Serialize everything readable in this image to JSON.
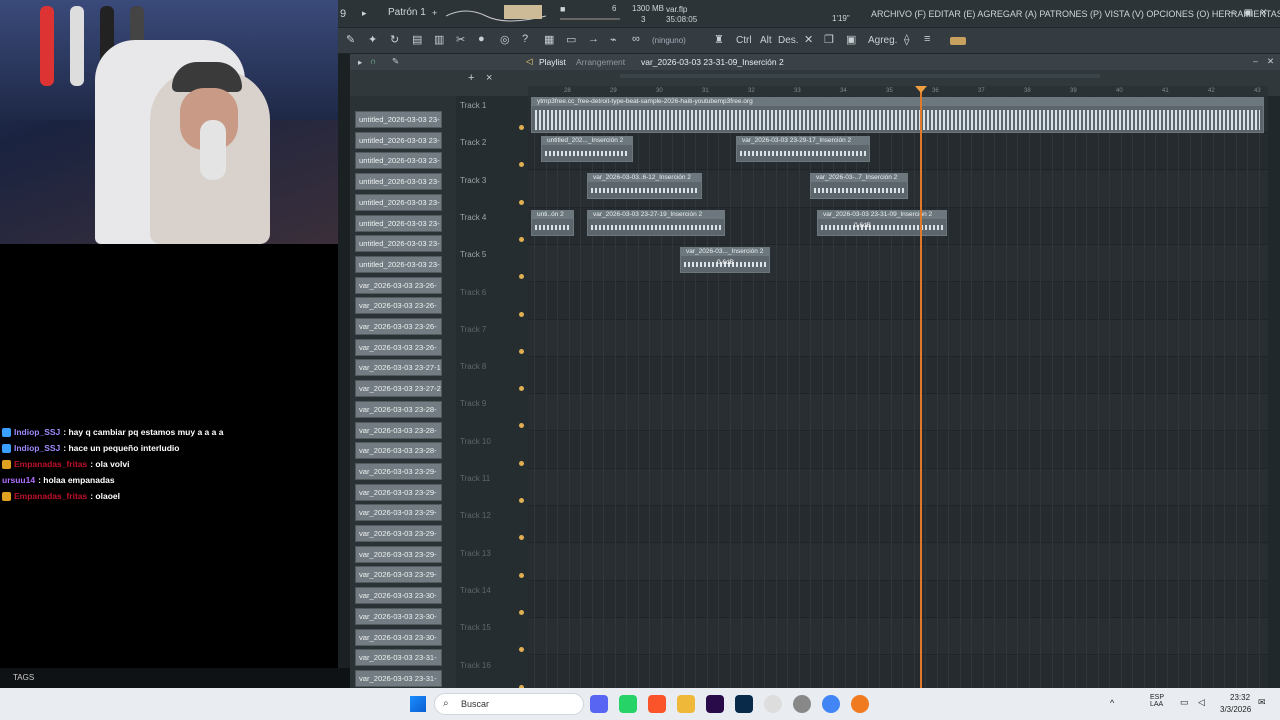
{
  "stream": {
    "chat": [
      {
        "user": "Indiop_SSJ",
        "message": ": hay q cambiar pq estamos muy a a a a",
        "user_color": "#9b8cff",
        "badge_color": "#3aa0ff"
      },
      {
        "user": "Indiop_SSJ",
        "message": ": hace un pequeño interludio",
        "user_color": "#9b8cff",
        "badge_color": "#3aa0ff"
      },
      {
        "user": "Empanadas_fritas",
        "message": ": ola volvi",
        "user_color": "#c0102a",
        "badge_color": "#e0a020"
      },
      {
        "user": "ursuu14",
        "message": ": holaa empanadas",
        "user_color": "#b070ff",
        "badge_color": null
      },
      {
        "user": "Empanadas_fritas",
        "message": ": olaoel",
        "user_color": "#c0102a",
        "badge_color": "#e0a020"
      }
    ],
    "tags_label": "TAGS"
  },
  "fl": {
    "pattern": "Patrón 1",
    "file": "var.flp",
    "memory": "1300 MB",
    "time": "35:08:05",
    "num_6": "6",
    "num_3": "3",
    "tempo": "1'19\"",
    "menu": "ARCHIVO (F) EDITAR (E) AGREGAR (A) PATRONES (P) VISTA (V) OPCIONES (O) HERRAMIENTAS (T) AYUDA",
    "snap": "(ninguno)",
    "mod_ctrl": "Ctrl",
    "mod_alt": "Alt",
    "mod_des": "Des.",
    "agreg": "Agreg.",
    "playlist_title": "Playlist",
    "playlist_sub": "Arrangement",
    "playlist_clip": "var_2026-03-03 23-31-09_Inserción 2",
    "ruler": [
      "28",
      "29",
      "30",
      "31",
      "32",
      "33",
      "34",
      "35",
      "36",
      "37",
      "38",
      "39",
      "40",
      "41",
      "42",
      "43"
    ],
    "picker_items": [
      "untitled_2026-03-03 23-",
      "untitled_2026-03-03 23-",
      "untitled_2026-03-03 23-",
      "untitled_2026-03-03 23-",
      "untitled_2026-03-03 23-",
      "untitled_2026-03-03 23-",
      "untitled_2026-03-03 23-",
      "untitled_2026-03-03 23-",
      "var_2026-03-03 23-26-",
      "var_2026-03-03 23-26-",
      "var_2026-03-03 23-26-",
      "var_2026-03-03 23-26-",
      "var_2026-03-03 23-27-1",
      "var_2026-03-03 23-27-2",
      "var_2026-03-03 23-28-",
      "var_2026-03-03 23-28-",
      "var_2026-03-03 23-28-",
      "var_2026-03-03 23-29-",
      "var_2026-03-03 23-29-",
      "var_2026-03-03 23-29-",
      "var_2026-03-03 23-29-",
      "var_2026-03-03 23-29-",
      "var_2026-03-03 23-29-",
      "var_2026-03-03 23-30-",
      "var_2026-03-03 23-30-",
      "var_2026-03-03 23-30-",
      "var_2026-03-03 23-31-",
      "var_2026-03-03 23-31-"
    ],
    "tracks": [
      "Track 1",
      "Track 2",
      "Track 3",
      "Track 4",
      "Track 5",
      "Track 6",
      "Track 7",
      "Track 8",
      "Track 9",
      "Track 10",
      "Track 11",
      "Track 12",
      "Track 13",
      "Track 14",
      "Track 15",
      "Track 16"
    ],
    "clips": [
      {
        "label": "ytmp3free.cc_free-detroit-type-beat-sample-2026-haiti-youtubemp3free.org",
        "db": ""
      },
      {
        "label": "untitled_202..._Inserción 2",
        "db": ""
      },
      {
        "label": "var_2026-03-03 23-29-17_Inserción 2",
        "db": ""
      },
      {
        "label": "var_2026-03-03..6-12_Inserción 2",
        "db": ""
      },
      {
        "label": "var_2026-03-..7_Inserción 2",
        "db": ""
      },
      {
        "label": "unti..ón 2",
        "db": ""
      },
      {
        "label": "var_2026-03-03 23-27-19_Inserción 2",
        "db": ""
      },
      {
        "label": "var_2026-03-03 23-31-09_Inserción 2",
        "db": "0.6dB"
      },
      {
        "label": "var_2026-03..._Inserción 2",
        "db": "0.6dB"
      }
    ]
  },
  "taskbar": {
    "search_placeholder": "Buscar",
    "lang": "ESP LAA",
    "time": "23:32",
    "date": "3/3/2026"
  }
}
